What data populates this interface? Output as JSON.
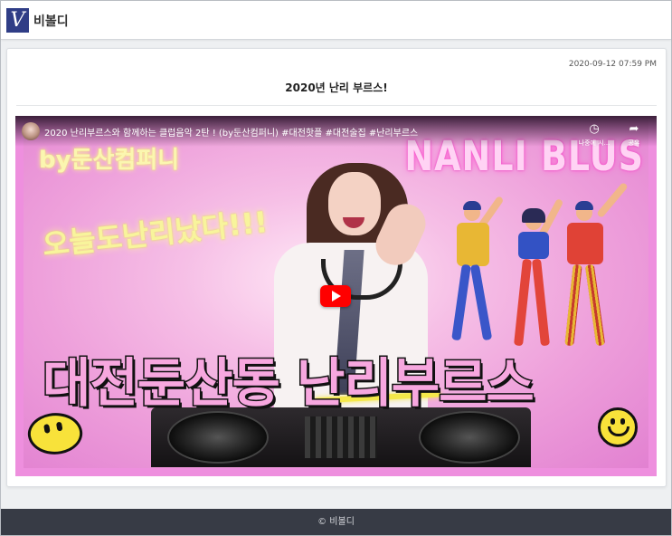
{
  "header": {
    "logo_letter": "V",
    "site_name": "비볼디"
  },
  "post": {
    "date": "2020-09-12 07:59 PM",
    "title": "2020년 난리 부르스!"
  },
  "video": {
    "title": "2020 난리부르스와 함께하는 클럽음악 2탄 ! (by둔산컴퍼니) #대전핫플 #대전술집 #난리부르스",
    "watch_later_label": "나중에 시...",
    "share_label": "공유",
    "overlay_by": "by둔산컴퍼니",
    "overlay_brand": "NANLI BLUS",
    "overlay_today": "오늘도난리났다!!!",
    "overlay_big": "대전둔산동 난리부르스",
    "accent_color": "#ee8fde",
    "play_color": "#ff0000"
  },
  "footer": {
    "text": "© 비볼디"
  }
}
